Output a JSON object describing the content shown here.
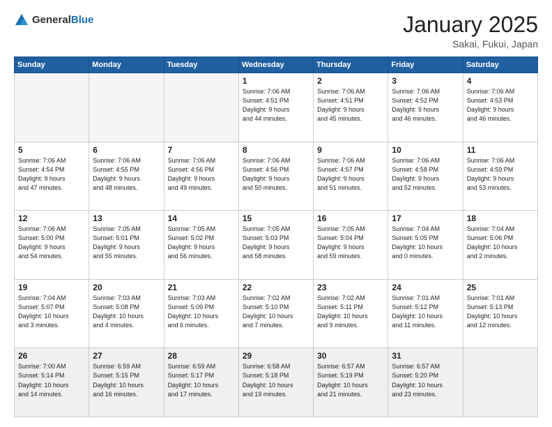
{
  "header": {
    "logo_general": "General",
    "logo_blue": "Blue",
    "title": "January 2025",
    "subtitle": "Sakai, Fukui, Japan"
  },
  "weekdays": [
    "Sunday",
    "Monday",
    "Tuesday",
    "Wednesday",
    "Thursday",
    "Friday",
    "Saturday"
  ],
  "weeks": [
    [
      {
        "day": "",
        "info": ""
      },
      {
        "day": "",
        "info": ""
      },
      {
        "day": "",
        "info": ""
      },
      {
        "day": "1",
        "info": "Sunrise: 7:06 AM\nSunset: 4:51 PM\nDaylight: 9 hours\nand 44 minutes."
      },
      {
        "day": "2",
        "info": "Sunrise: 7:06 AM\nSunset: 4:51 PM\nDaylight: 9 hours\nand 45 minutes."
      },
      {
        "day": "3",
        "info": "Sunrise: 7:06 AM\nSunset: 4:52 PM\nDaylight: 9 hours\nand 46 minutes."
      },
      {
        "day": "4",
        "info": "Sunrise: 7:06 AM\nSunset: 4:53 PM\nDaylight: 9 hours\nand 46 minutes."
      }
    ],
    [
      {
        "day": "5",
        "info": "Sunrise: 7:06 AM\nSunset: 4:54 PM\nDaylight: 9 hours\nand 47 minutes."
      },
      {
        "day": "6",
        "info": "Sunrise: 7:06 AM\nSunset: 4:55 PM\nDaylight: 9 hours\nand 48 minutes."
      },
      {
        "day": "7",
        "info": "Sunrise: 7:06 AM\nSunset: 4:56 PM\nDaylight: 9 hours\nand 49 minutes."
      },
      {
        "day": "8",
        "info": "Sunrise: 7:06 AM\nSunset: 4:56 PM\nDaylight: 9 hours\nand 50 minutes."
      },
      {
        "day": "9",
        "info": "Sunrise: 7:06 AM\nSunset: 4:57 PM\nDaylight: 9 hours\nand 51 minutes."
      },
      {
        "day": "10",
        "info": "Sunrise: 7:06 AM\nSunset: 4:58 PM\nDaylight: 9 hours\nand 52 minutes."
      },
      {
        "day": "11",
        "info": "Sunrise: 7:06 AM\nSunset: 4:59 PM\nDaylight: 9 hours\nand 53 minutes."
      }
    ],
    [
      {
        "day": "12",
        "info": "Sunrise: 7:06 AM\nSunset: 5:00 PM\nDaylight: 9 hours\nand 54 minutes."
      },
      {
        "day": "13",
        "info": "Sunrise: 7:05 AM\nSunset: 5:01 PM\nDaylight: 9 hours\nand 55 minutes."
      },
      {
        "day": "14",
        "info": "Sunrise: 7:05 AM\nSunset: 5:02 PM\nDaylight: 9 hours\nand 56 minutes."
      },
      {
        "day": "15",
        "info": "Sunrise: 7:05 AM\nSunset: 5:03 PM\nDaylight: 9 hours\nand 58 minutes."
      },
      {
        "day": "16",
        "info": "Sunrise: 7:05 AM\nSunset: 5:04 PM\nDaylight: 9 hours\nand 59 minutes."
      },
      {
        "day": "17",
        "info": "Sunrise: 7:04 AM\nSunset: 5:05 PM\nDaylight: 10 hours\nand 0 minutes."
      },
      {
        "day": "18",
        "info": "Sunrise: 7:04 AM\nSunset: 5:06 PM\nDaylight: 10 hours\nand 2 minutes."
      }
    ],
    [
      {
        "day": "19",
        "info": "Sunrise: 7:04 AM\nSunset: 5:07 PM\nDaylight: 10 hours\nand 3 minutes."
      },
      {
        "day": "20",
        "info": "Sunrise: 7:03 AM\nSunset: 5:08 PM\nDaylight: 10 hours\nand 4 minutes."
      },
      {
        "day": "21",
        "info": "Sunrise: 7:03 AM\nSunset: 5:09 PM\nDaylight: 10 hours\nand 6 minutes."
      },
      {
        "day": "22",
        "info": "Sunrise: 7:02 AM\nSunset: 5:10 PM\nDaylight: 10 hours\nand 7 minutes."
      },
      {
        "day": "23",
        "info": "Sunrise: 7:02 AM\nSunset: 5:11 PM\nDaylight: 10 hours\nand 9 minutes."
      },
      {
        "day": "24",
        "info": "Sunrise: 7:01 AM\nSunset: 5:12 PM\nDaylight: 10 hours\nand 11 minutes."
      },
      {
        "day": "25",
        "info": "Sunrise: 7:01 AM\nSunset: 5:13 PM\nDaylight: 10 hours\nand 12 minutes."
      }
    ],
    [
      {
        "day": "26",
        "info": "Sunrise: 7:00 AM\nSunset: 5:14 PM\nDaylight: 10 hours\nand 14 minutes."
      },
      {
        "day": "27",
        "info": "Sunrise: 6:59 AM\nSunset: 5:15 PM\nDaylight: 10 hours\nand 16 minutes."
      },
      {
        "day": "28",
        "info": "Sunrise: 6:59 AM\nSunset: 5:17 PM\nDaylight: 10 hours\nand 17 minutes."
      },
      {
        "day": "29",
        "info": "Sunrise: 6:58 AM\nSunset: 5:18 PM\nDaylight: 10 hours\nand 19 minutes."
      },
      {
        "day": "30",
        "info": "Sunrise: 6:57 AM\nSunset: 5:19 PM\nDaylight: 10 hours\nand 21 minutes."
      },
      {
        "day": "31",
        "info": "Sunrise: 6:57 AM\nSunset: 5:20 PM\nDaylight: 10 hours\nand 23 minutes."
      },
      {
        "day": "",
        "info": ""
      }
    ]
  ]
}
